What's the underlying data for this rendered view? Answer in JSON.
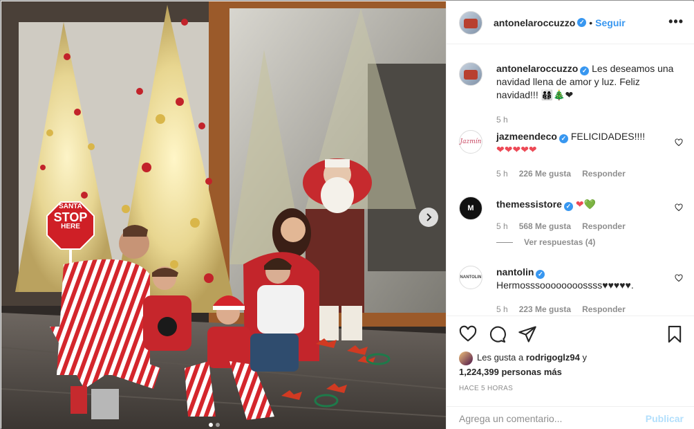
{
  "post": {
    "username": "antonelaroccuzzo",
    "follow_label": "Seguir",
    "separator": "•",
    "more_label": "•••"
  },
  "photo": {
    "sign_line1": "SANTA",
    "sign_line2": "STOP",
    "sign_line3": "HERE",
    "carousel_dots": 2
  },
  "caption": {
    "username": "antonelaroccuzzo",
    "text": "Les deseamos una navidad llena de amor y luz. Feliz navidad!!! 👨‍👩‍👦‍👦🎄❤",
    "age": "5 h"
  },
  "comments": [
    {
      "username": "jazmeendeco",
      "verified": true,
      "avatar_text": "Jazmín",
      "text": "FELICIDADES!!!!",
      "text2": "❤❤❤❤❤",
      "age": "5 h",
      "likes": "226 Me gusta",
      "reply": "Responder"
    },
    {
      "username": "themessistore",
      "verified": true,
      "avatar_text": "M",
      "text": "❤💚",
      "age": "5 h",
      "likes": "568 Me gusta",
      "reply": "Responder",
      "view_replies": "Ver respuestas (4)"
    },
    {
      "username": "nantolin",
      "verified": true,
      "avatar_text": "NANTOLIN",
      "text": "Hermosssoooooooossss♥♥♥♥♥.",
      "age": "5 h",
      "likes": "223 Me gusta",
      "reply": "Responder"
    }
  ],
  "likes": {
    "prefix": "Les gusta a",
    "user": "rodrigoglz94",
    "connector": "y",
    "count": "1,224,399 personas más"
  },
  "timestamp": "HACE 5 HORAS",
  "comment_box": {
    "placeholder": "Agrega un comentario...",
    "publish_label": "Publicar"
  },
  "colors": {
    "accent": "#3897f0",
    "publish_disabled": "#b2dffc",
    "heart_red": "#ed4956"
  }
}
